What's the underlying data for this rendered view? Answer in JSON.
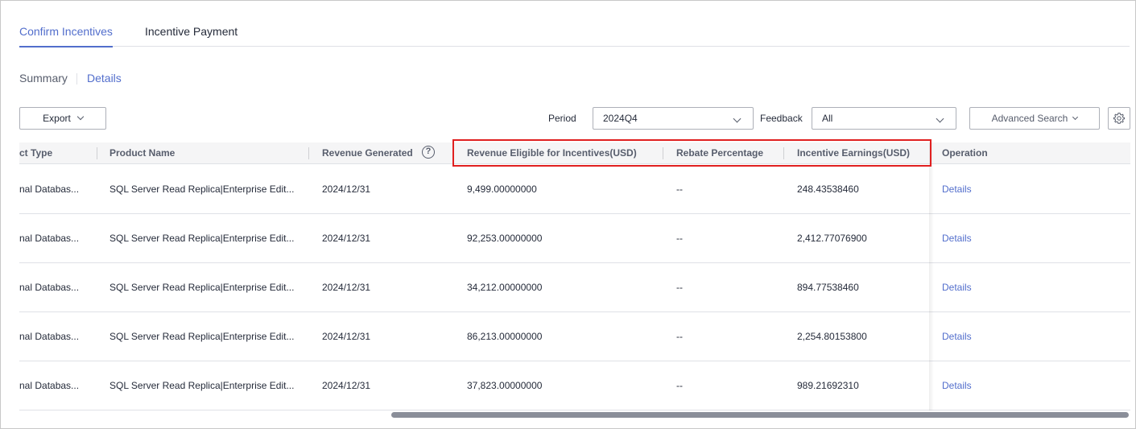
{
  "tabs": [
    {
      "label": "Confirm Incentives",
      "active": true
    },
    {
      "label": "Incentive Payment",
      "active": false
    }
  ],
  "subnav": {
    "summary": "Summary",
    "details": "Details",
    "active": "Details"
  },
  "toolbar": {
    "export_label": "Export",
    "period_label": "Period",
    "period_value": "2024Q4",
    "feedback_label": "Feedback",
    "feedback_value": "All",
    "advanced_search_label": "Advanced Search"
  },
  "table": {
    "columns": [
      "ct Type",
      "Product Name",
      "Revenue Generated",
      "Revenue Eligible for Incentives(USD)",
      "Rebate Percentage",
      "Incentive Earnings(USD)",
      "Operation"
    ],
    "rows": [
      {
        "product_type": "nal Databas...",
        "product_name": "SQL Server Read Replica|Enterprise Edit...",
        "revenue_generated": "2024/12/31",
        "revenue_eligible": "9,499.00000000",
        "rebate": "--",
        "earnings": "248.43538460",
        "operation": "Details"
      },
      {
        "product_type": "nal Databas...",
        "product_name": "SQL Server Read Replica|Enterprise Edit...",
        "revenue_generated": "2024/12/31",
        "revenue_eligible": "92,253.00000000",
        "rebate": "--",
        "earnings": "2,412.77076900",
        "operation": "Details"
      },
      {
        "product_type": "nal Databas...",
        "product_name": "SQL Server Read Replica|Enterprise Edit...",
        "revenue_generated": "2024/12/31",
        "revenue_eligible": "34,212.00000000",
        "rebate": "--",
        "earnings": "894.77538460",
        "operation": "Details"
      },
      {
        "product_type": "nal Databas...",
        "product_name": "SQL Server Read Replica|Enterprise Edit...",
        "revenue_generated": "2024/12/31",
        "revenue_eligible": "86,213.00000000",
        "rebate": "--",
        "earnings": "2,254.80153800",
        "operation": "Details"
      },
      {
        "product_type": "nal Databas...",
        "product_name": "SQL Server Read Replica|Enterprise Edit...",
        "revenue_generated": "2024/12/31",
        "revenue_eligible": "37,823.00000000",
        "rebate": "--",
        "earnings": "989.21692310",
        "operation": "Details"
      }
    ]
  },
  "icons": {
    "help": "question-circle-icon",
    "settings": "gear-icon",
    "dropdown": "chevron-down-icon"
  },
  "colors": {
    "accent": "#526ecc",
    "highlight_box": "#e02020",
    "header_bg": "#f5f5f6"
  }
}
